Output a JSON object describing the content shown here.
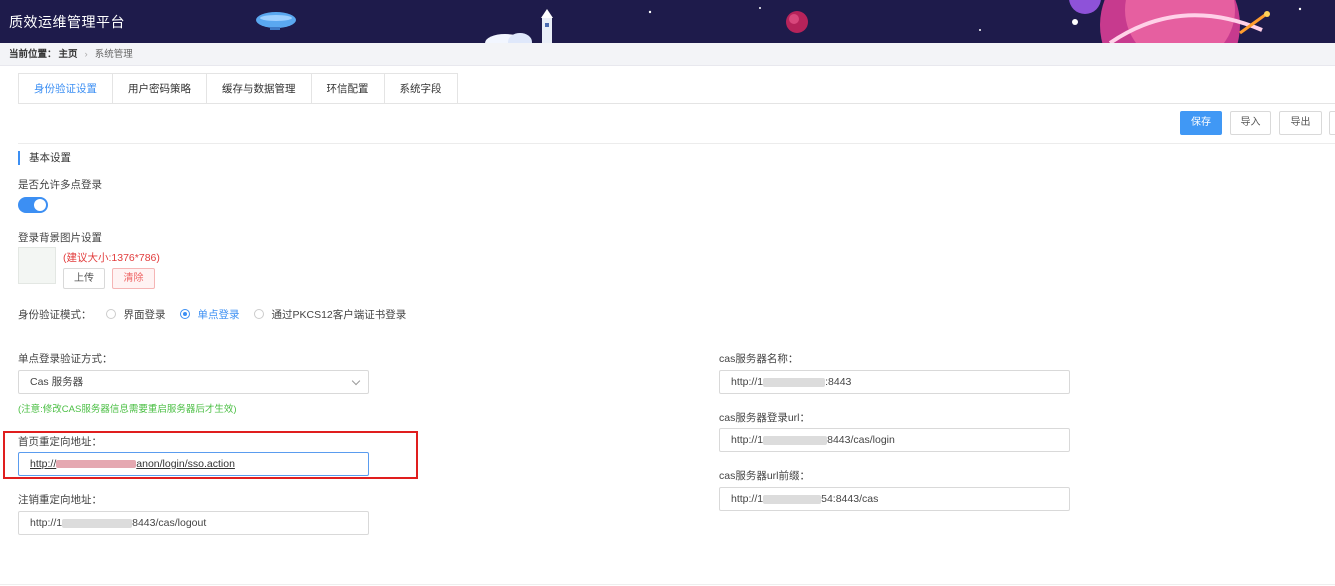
{
  "app": {
    "title": "质效运维管理平台"
  },
  "breadcrumb": {
    "lead": "当前位置：",
    "home": "主页",
    "separator": "›",
    "page": "系统管理"
  },
  "tabs": [
    {
      "label": "身份验证设置",
      "active": true
    },
    {
      "label": "用户密码策略"
    },
    {
      "label": "缓存与数据管理"
    },
    {
      "label": "环信配置"
    },
    {
      "label": "系统字段"
    }
  ],
  "toolbar": {
    "save_label": "保存",
    "import_label": "导入",
    "export_label": "导出"
  },
  "section": {
    "title": "基本设置"
  },
  "multi_login": {
    "label": "是否允许多点登录",
    "enabled": true
  },
  "background": {
    "label": "登录背景图片设置",
    "size_hint": "(建议大小:1376*786)",
    "upload_label": "上传",
    "clear_label": "清除"
  },
  "auth_mode": {
    "label": "身份验证模式：",
    "options": [
      "界面登录",
      "单点登录",
      "通过PKCS12客户端证书登录"
    ],
    "selected": "单点登录"
  },
  "sso": {
    "method_label": "单点登录验证方式：",
    "method_value": "Cas 服务器",
    "note": "(注意:修改CAS服务器信息需要重启服务器后才生效)",
    "home_redirect_label": "首页重定向地址：",
    "home_redirect_prefix": "http://",
    "home_redirect_suffix": "anon/login/sso.action",
    "logout_redirect_label": "注销重定向地址：",
    "logout_redirect_prefix": "http://1",
    "logout_redirect_suffix": "8443/cas/logout"
  },
  "cas": {
    "server_name_label": "cas服务器名称：",
    "server_name_prefix": "http://1",
    "server_name_suffix": ":8443",
    "login_url_label": "cas服务器登录url：",
    "login_url_prefix": "http://1",
    "login_url_suffix": "8443/cas/login",
    "url_prefix_label": "cas服务器url前缀：",
    "url_prefix_prefix": "http://1",
    "url_prefix_suffix": "54:8443/cas"
  },
  "colors": {
    "header_bg": "#1e1b4b",
    "accent": "#3c8ff3",
    "danger": "#e23d3d",
    "note": "#4bbf44",
    "highlight": "#e01e1e"
  }
}
